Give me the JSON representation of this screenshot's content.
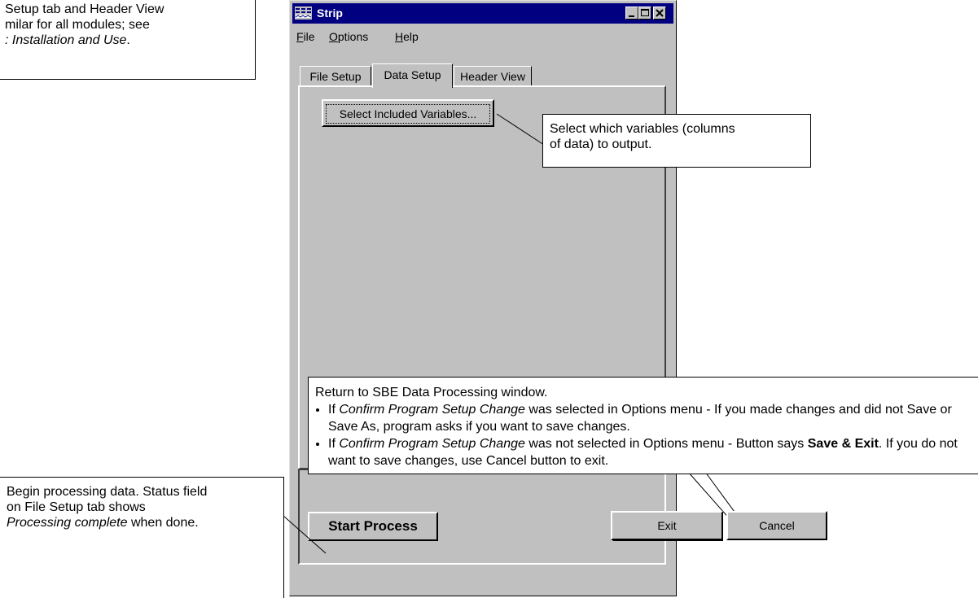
{
  "annotations": {
    "top_left": {
      "line1": "Setup tab and Header View",
      "line2": "milar for all modules; see",
      "line3_italic": ": Installation and Use",
      "line3_tail": "."
    },
    "select_vars": {
      "line1": "Select which variables (columns",
      "line2": "of data) to output."
    },
    "exit_note": {
      "intro": "Return to SBE Data Processing window.",
      "bullet1_italic": "Confirm Program Setup Change",
      "bullet1_prefix": "If ",
      "bullet1_rest": " was selected in Options menu - If you made changes and did not Save or Save As, program asks if you want to save changes.",
      "bullet2_prefix": "If ",
      "bullet2_italic": "Confirm Program Setup Change",
      "bullet2_mid": " was not selected in Options menu - Button says ",
      "bullet2_bold": "Save & Exit",
      "bullet2_rest": ". If you do not want to save changes, use Cancel button to exit."
    },
    "start_note": {
      "line1": "Begin processing data. Status field",
      "line2": "on File Setup tab shows",
      "line3_italic": "Processing complete",
      "line3_rest": " when done."
    }
  },
  "window": {
    "title": "Strip",
    "menu": [
      "File",
      "Options",
      "Help"
    ],
    "menu_underline": [
      "F",
      "O",
      "H"
    ],
    "tabs": [
      "File Setup",
      "Data Setup",
      "Header View"
    ],
    "active_tab": "Data Setup",
    "select_button": "Select Included Variables...",
    "start_button": "Start Process",
    "exit_button": "Exit",
    "cancel_button": "Cancel"
  },
  "colors": {
    "titlebar": "#000080",
    "face": "#c0c0c0"
  }
}
